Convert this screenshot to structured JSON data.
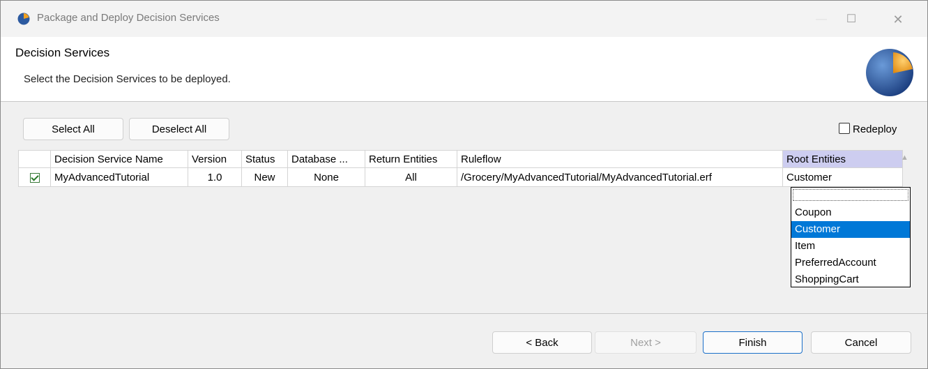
{
  "window": {
    "title": "Package and Deploy Decision Services"
  },
  "window_controls": {
    "minimize": "—",
    "maximize": "☐",
    "close": "✕"
  },
  "header": {
    "title": "Decision Services",
    "description": "Select the Decision Services to be deployed."
  },
  "toolbar": {
    "select_all": "Select All",
    "deselect_all": "Deselect All",
    "redeploy_label": "Redeploy",
    "redeploy_checked": false
  },
  "table": {
    "columns": [
      "Decision Service Name",
      "Version",
      "Status",
      "Database ...",
      "Return Entities",
      "Ruleflow",
      "Root Entities"
    ],
    "rows": [
      {
        "checked": true,
        "name": "MyAdvancedTutorial",
        "version": "1.0",
        "status": "New",
        "database": "None",
        "return_entities": "All",
        "ruleflow": "/Grocery/MyAdvancedTutorial/MyAdvancedTutorial.erf",
        "root_entities": "Customer"
      }
    ]
  },
  "root_entities_dropdown": {
    "options": [
      "",
      "Coupon",
      "Customer",
      "Item",
      "PreferredAccount",
      "ShoppingCart"
    ],
    "selected": "Customer"
  },
  "footer": {
    "back": "< Back",
    "next": "Next >",
    "finish": "Finish",
    "cancel": "Cancel"
  },
  "colors": {
    "selection": "#0078d7",
    "header_highlight": "#cdcdf0",
    "disabled_text": "#a0a0a0"
  }
}
